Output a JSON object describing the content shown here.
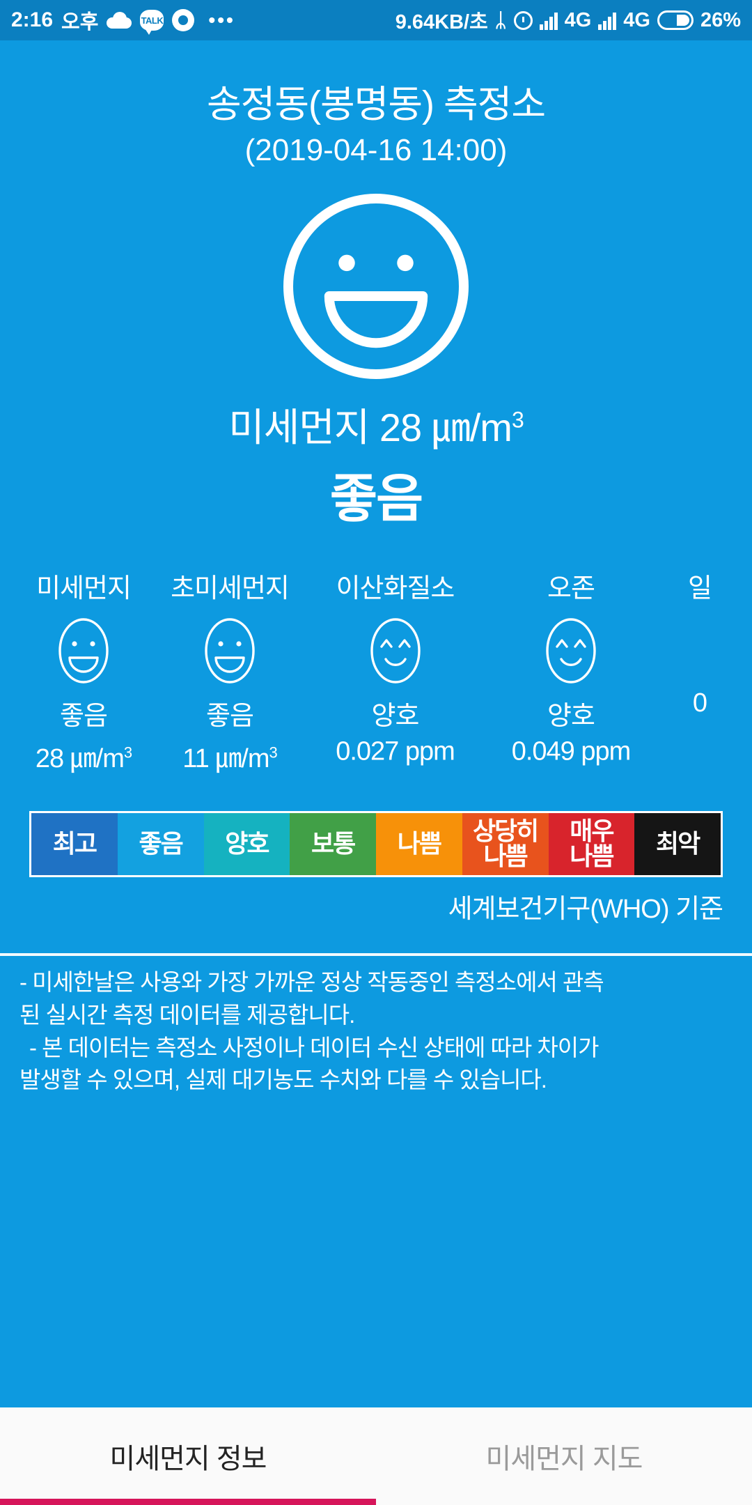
{
  "status_bar": {
    "time": "2:16",
    "ampm": "오후",
    "icons": [
      "cloud-icon",
      "kakaotalk-icon",
      "record-icon",
      "more-dots-icon"
    ],
    "network_speed": "9.64KB/초",
    "bluetooth": "bluetooth-icon",
    "alarm": "alarm-icon",
    "sim1_network": "4G",
    "sim2_network": "4G",
    "battery_percent": "26%"
  },
  "header": {
    "station_name": "송정동(봉명동) 측정소",
    "measured_at": "(2019-04-16 14:00)"
  },
  "main": {
    "value_line": "미세먼지 28 ㎛/m",
    "value_exponent": "3",
    "grade": "좋음",
    "face": "big-smile-face-icon"
  },
  "pollutants": [
    {
      "label": "미세먼지",
      "face": "smile-open-mouth-icon",
      "grade": "좋음",
      "value": "28 ㎛/m",
      "exponent": "3"
    },
    {
      "label": "초미세먼지",
      "face": "smile-open-mouth-icon",
      "grade": "좋음",
      "value": "11 ㎛/m",
      "exponent": "3"
    },
    {
      "label": "이산화질소",
      "face": "happy-eyes-smile-icon",
      "grade": "양호",
      "value": "0.027 ppm",
      "exponent": ""
    },
    {
      "label": "오존",
      "face": "happy-eyes-smile-icon",
      "grade": "양호",
      "value": "0.049 ppm",
      "exponent": ""
    },
    {
      "label": "일",
      "face": "",
      "grade": "",
      "value": "0",
      "exponent": ""
    }
  ],
  "legend": {
    "items": [
      {
        "label1": "최고",
        "label2": "",
        "color": "#1f72c4"
      },
      {
        "label1": "좋음",
        "label2": "",
        "color": "#13a1e0"
      },
      {
        "label1": "양호",
        "label2": "",
        "color": "#15b2c0"
      },
      {
        "label1": "보통",
        "label2": "",
        "color": "#41a047"
      },
      {
        "label1": "나쁨",
        "label2": "",
        "color": "#f79109"
      },
      {
        "label1": "상당히",
        "label2": "나쁨",
        "color": "#e8531d"
      },
      {
        "label1": "매우",
        "label2": "나쁨",
        "color": "#d8242c"
      },
      {
        "label1": "최악",
        "label2": "",
        "color": "#151515"
      }
    ],
    "note": "세계보건기구(WHO) 기준"
  },
  "disclaimer": {
    "line1": "- 미세한날은 사용와 가장 가까운 정상 작동중인 측정소에서 관측",
    "line2": "된 실시간 측정 데이터를 제공합니다.",
    "line3": "- 본 데이터는 측정소 사정이나 데이터 수신 상태에 따라 차이가",
    "line4": "발생할 수 있으며, 실제 대기농도 수치와 다를 수 있습니다."
  },
  "tabs": [
    {
      "label": "미세먼지 정보",
      "active": true
    },
    {
      "label": "미세먼지 지도",
      "active": false
    }
  ],
  "colors": {
    "brand_blue": "#0d9ae0",
    "statusbar_blue": "#0b7fc0",
    "tab_indicator": "#d6155a"
  }
}
